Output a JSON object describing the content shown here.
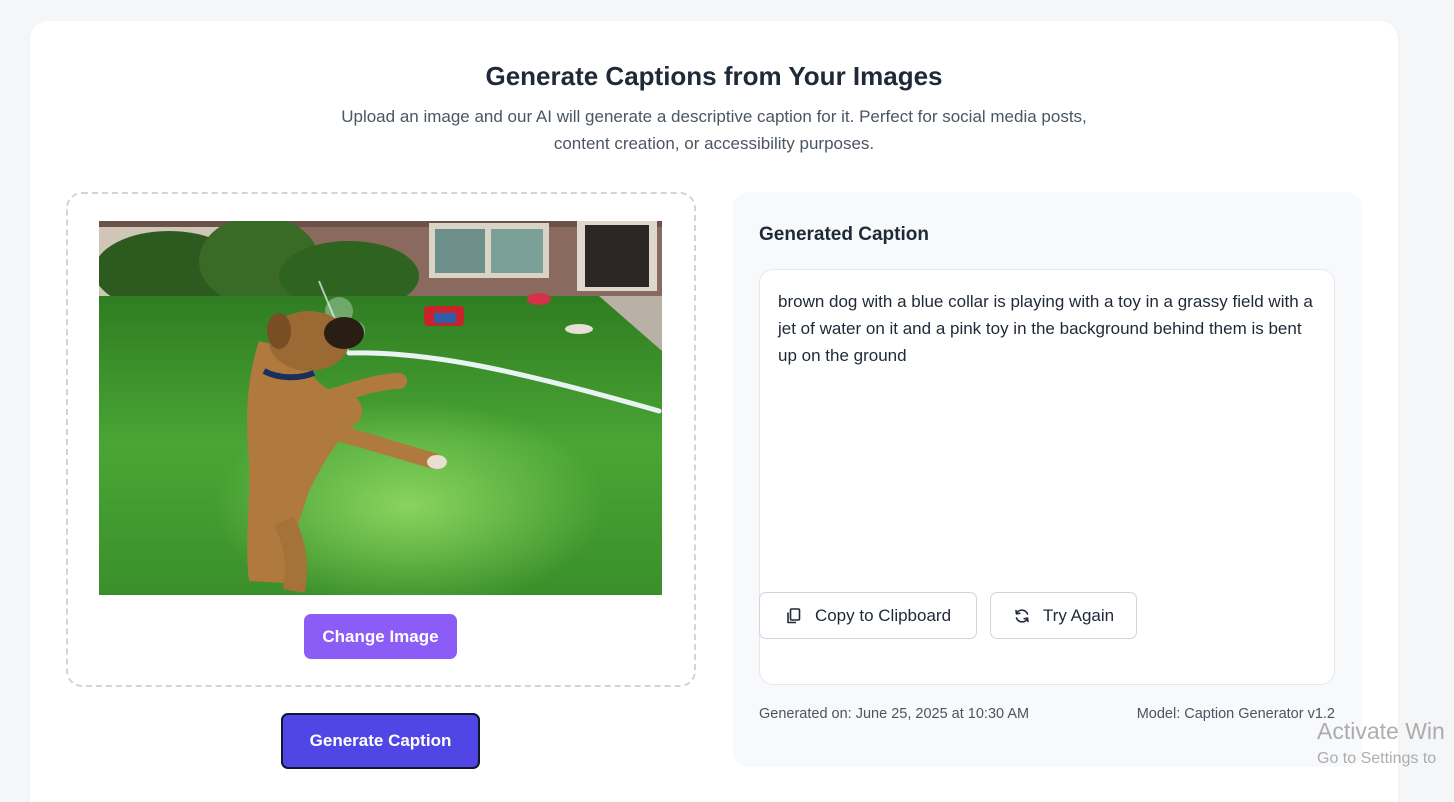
{
  "header": {
    "title": "Generate Captions from Your Images",
    "subtitle": "Upload an image and our AI will generate a descriptive caption for it. Perfect for social media posts, content creation, or accessibility purposes."
  },
  "upload": {
    "change_label": "Change Image",
    "generate_label": "Generate Caption"
  },
  "result": {
    "heading": "Generated Caption",
    "caption": "brown dog with a blue collar is playing with a toy in a grassy field with a jet of water on it and a pink toy in the background behind them is bent up on the ground",
    "generated_on": "Generated on: June 25, 2025 at 10:30 AM",
    "model": "Model: Caption Generator v1.2",
    "copy_label": "Copy to Clipboard",
    "retry_label": "Try Again",
    "copy_icon": "copy-icon",
    "retry_icon": "refresh-icon"
  },
  "watermark": {
    "title": "Activate Win",
    "subtitle": "Go to Settings to"
  },
  "colors": {
    "accent_purple": "#8b5cf6",
    "accent_indigo": "#4f46e5",
    "panel_bg": "#f8f9fb",
    "page_bg": "#f5f6f8"
  }
}
